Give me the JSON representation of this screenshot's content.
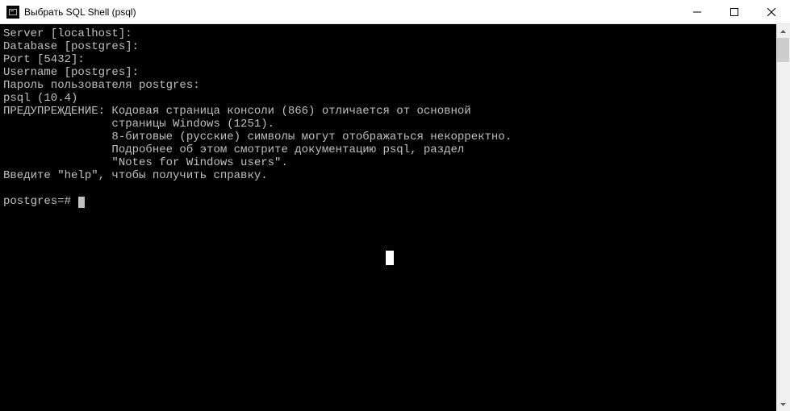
{
  "window": {
    "title": "Выбрать SQL Shell (psql)"
  },
  "console": {
    "lines": [
      "Server [localhost]:",
      "Database [postgres]:",
      "Port [5432]:",
      "Username [postgres]:",
      "Пароль пользователя postgres:",
      "psql (10.4)",
      "ПРЕДУПРЕЖДЕНИЕ: Кодовая страница консоли (866) отличается от основной",
      "                страницы Windows (1251).",
      "                8-битовые (русские) символы могут отображаться некорректно.",
      "                Подробнее об этом смотрите документацию psql, раздел",
      "                \"Notes for Windows users\".",
      "Введите \"help\", чтобы получить справку.",
      "",
      "postgres=#"
    ]
  }
}
